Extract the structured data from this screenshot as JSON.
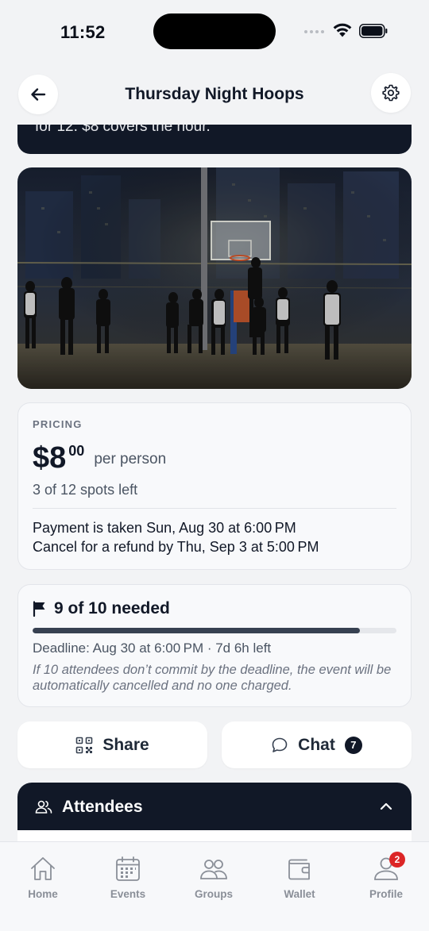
{
  "status_bar": {
    "time": "11:52"
  },
  "header": {
    "title": "Thursday Night Hoops"
  },
  "description": {
    "text": "for 12. $8 covers the hour."
  },
  "pricing": {
    "label": "PRICING",
    "price_dollars": "$8",
    "price_cents": "00",
    "unit": "per person",
    "spots": "3 of 12 spots left",
    "payment_line": "Payment is taken Sun, Aug 30 at 6:00 PM",
    "refund_line": "Cancel for a refund by Thu, Sep 3 at 5:00 PM"
  },
  "threshold": {
    "title": "9 of 10 needed",
    "progress_fraction": 0.9,
    "deadline": "Deadline: Aug 30 at 6:00 PM · 7d 6h left",
    "warning": "If 10 attendees don’t commit by the deadline, the event will be automatically cancelled and no one charged."
  },
  "actions": {
    "share_label": "Share",
    "chat_label": "Chat",
    "chat_count": "7"
  },
  "attendees": {
    "title": "Attendees"
  },
  "tabs": [
    {
      "label": "Home",
      "icon": "home-icon"
    },
    {
      "label": "Events",
      "icon": "calendar-icon"
    },
    {
      "label": "Groups",
      "icon": "users-icon"
    },
    {
      "label": "Wallet",
      "icon": "wallet-icon"
    },
    {
      "label": "Profile",
      "icon": "user-icon",
      "badge": "2"
    }
  ],
  "colors": {
    "dark": "#111827",
    "badge": "#dc2626",
    "tab_inactive": "#8a8f98"
  }
}
